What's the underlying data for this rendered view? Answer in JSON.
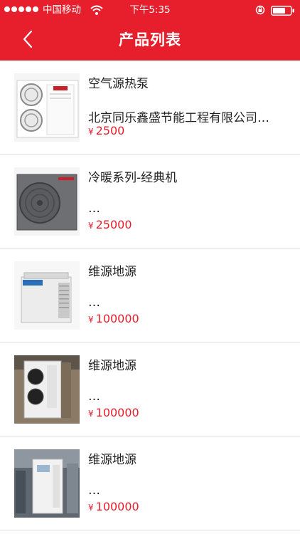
{
  "status_bar": {
    "carrier": "中国移动",
    "time": "下午5:35"
  },
  "nav": {
    "title": "产品列表"
  },
  "colors": {
    "brand_red": "#e71e2c",
    "price_red": "#e71e2c"
  },
  "currency_symbol": "¥",
  "products": [
    {
      "name": "空气源热泵",
      "description": "北京同乐鑫盛节能工程有限公司…",
      "price": "2500"
    },
    {
      "name": "冷暖系列-经典机",
      "description": "…",
      "price": "25000"
    },
    {
      "name": "维源地源",
      "description": "…",
      "price": "100000"
    },
    {
      "name": "维源地源",
      "description": "…",
      "price": "100000"
    },
    {
      "name": "维源地源",
      "description": "…",
      "price": "100000"
    }
  ]
}
